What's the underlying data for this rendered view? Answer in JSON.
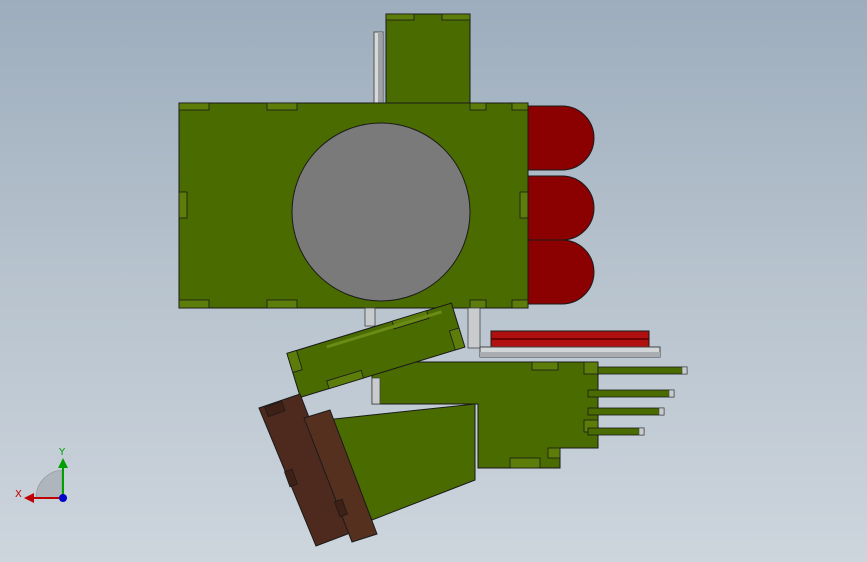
{
  "viewport": {
    "background_top": "#9dadbd",
    "background_bottom": "#cdd5dd"
  },
  "colors": {
    "body_green": "#4a6b00",
    "body_green_light": "#5c7d0a",
    "outline": "#1a1a1a",
    "bore_gray": "#7a7a7a",
    "dark_red": "#8b0000",
    "red_plate": "#b01010",
    "brown": "#4e2a1e",
    "steel": "#c9cccf",
    "axis_x": "#c00000",
    "axis_y": "#00a000",
    "axis_z": "#0000cc"
  },
  "triad": {
    "x_label": "X",
    "y_label": "Y"
  }
}
